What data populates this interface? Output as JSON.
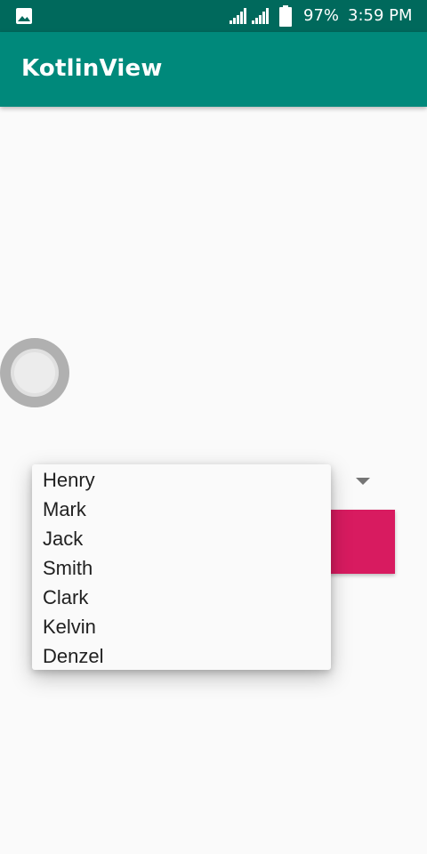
{
  "status_bar": {
    "left_icon": "gallery-icon",
    "signal_icons": [
      "signal-icon",
      "signal-icon"
    ],
    "battery_icon": "battery-icon",
    "battery_percent": "97%",
    "time": "3:59 PM",
    "background_color": "#00695c"
  },
  "app_bar": {
    "title": "KotlinView",
    "background_color": "#00897b"
  },
  "radio_button": {
    "checked": false
  },
  "spinner": {
    "icon": "dropdown-arrow-icon",
    "options": [
      "Henry",
      "Mark",
      "Jack",
      "Smith",
      "Clark",
      "Kelvin",
      "Denzel"
    ]
  },
  "pink_button": {
    "color": "#d81b60"
  }
}
